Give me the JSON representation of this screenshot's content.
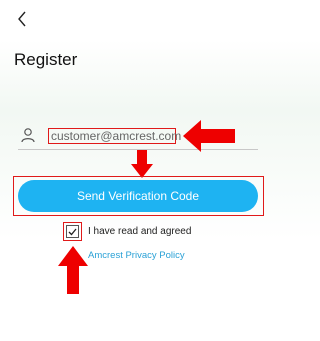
{
  "header": {
    "title": "Register"
  },
  "form": {
    "email_value": "customer@amcrest.com",
    "send_button_label": "Send Verification Code",
    "agree_label": "I have read and agreed",
    "policy_link": "Amcrest Privacy Policy",
    "agreed": true
  },
  "colors": {
    "accent_blue": "#1eb3f2",
    "link_blue": "#2aa1d6",
    "annotation_red": "#e01a1a"
  }
}
